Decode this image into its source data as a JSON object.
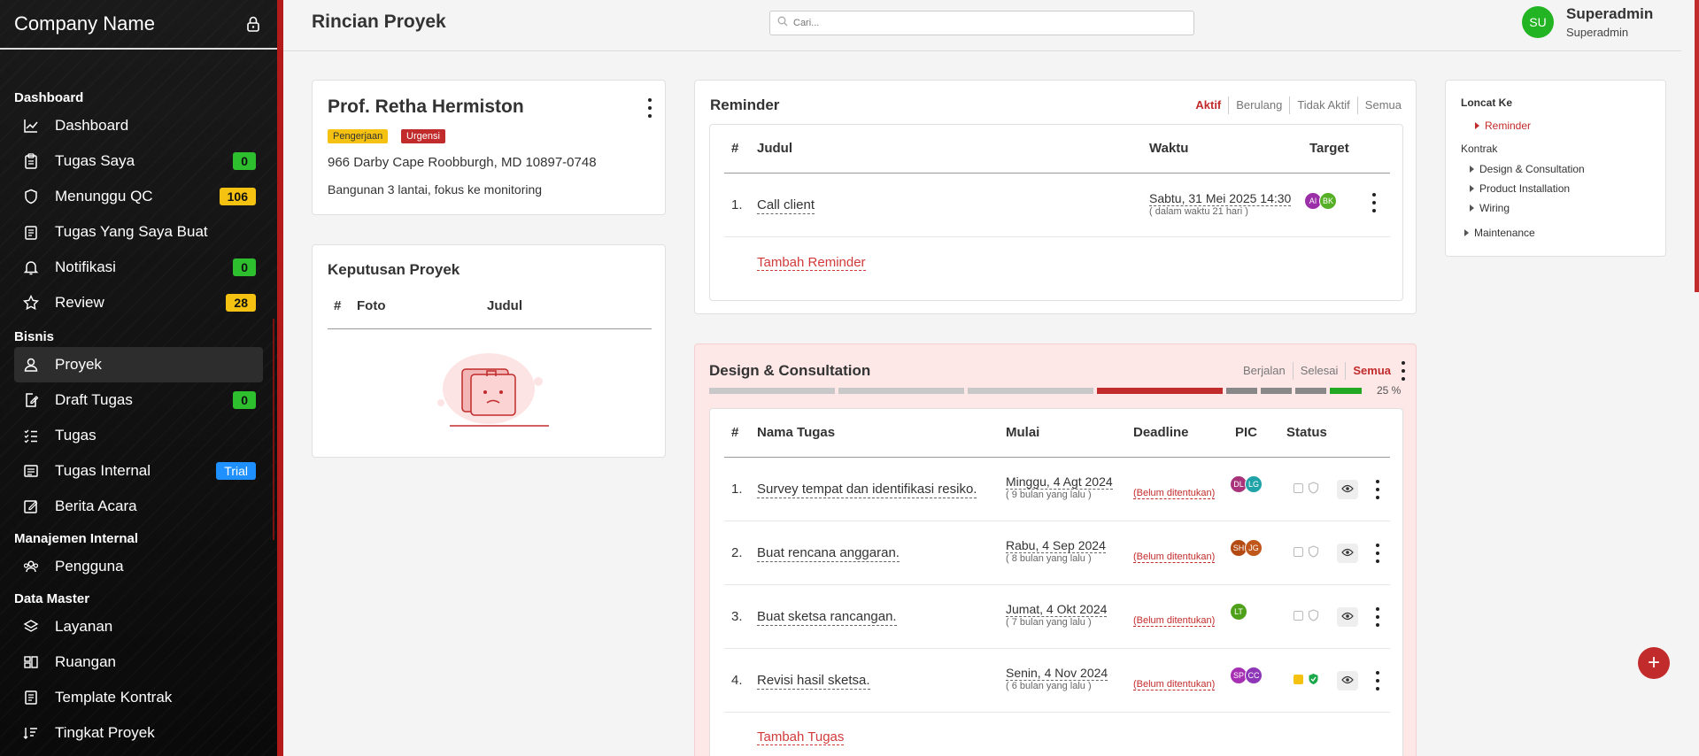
{
  "sidebar": {
    "brand": "Company Name",
    "sections": {
      "dashboard": "Dashboard",
      "bisnis": "Bisnis",
      "manajemen": "Manajemen Internal",
      "datamaster": "Data Master"
    },
    "items": {
      "dashboard": "Dashboard",
      "tugas_saya": "Tugas Saya",
      "menunggu_qc": "Menunggu QC",
      "tugas_dibuat": "Tugas Yang Saya Buat",
      "notifikasi": "Notifikasi",
      "review": "Review",
      "proyek": "Proyek",
      "draft_tugas": "Draft Tugas",
      "tugas": "Tugas",
      "tugas_internal": "Tugas Internal",
      "berita_acara": "Berita Acara",
      "pengguna": "Pengguna",
      "layanan": "Layanan",
      "ruangan": "Ruangan",
      "template_kontrak": "Template Kontrak",
      "tingkat_proyek": "Tingkat Proyek"
    },
    "badges": {
      "tugas_saya": "0",
      "menunggu_qc": "106",
      "notifikasi": "0",
      "review": "28",
      "draft_tugas": "0",
      "tugas_internal": "Trial"
    }
  },
  "header": {
    "title": "Rincian Proyek",
    "search_placeholder": "Cari...",
    "user_initials": "SU",
    "user_name": "Superadmin",
    "user_role": "Superadmin"
  },
  "client": {
    "name": "Prof. Retha Hermiston",
    "tag1": "Pengerjaan",
    "tag2": "Urgensi",
    "address": "966 Darby Cape Roobburgh, MD 10897-0748",
    "description": "Bangunan 3 lantai, fokus ke monitoring"
  },
  "keputusan": {
    "title": "Keputusan Proyek",
    "col_no": "#",
    "col_foto": "Foto",
    "col_judul": "Judul"
  },
  "reminder": {
    "title": "Reminder",
    "tabs": [
      "Aktif",
      "Berulang",
      "Tidak Aktif",
      "Semua"
    ],
    "col_no": "#",
    "col_judul": "Judul",
    "col_waktu": "Waktu",
    "col_target": "Target",
    "row": {
      "no": "1.",
      "judul": "Call client",
      "waktu": "Sabtu, 31 Mei 2025 14:30",
      "waktu_sub": "( dalam waktu 21 hari )",
      "targets": [
        "AI",
        "BK"
      ]
    },
    "add_label": "Tambah Reminder"
  },
  "design": {
    "title": "Design & Consultation",
    "tabs": [
      "Berjalan",
      "Selesai",
      "Semua"
    ],
    "progress": "25 %",
    "progress_segments": [
      "#c8c8c8",
      "#c8c8c8",
      "#c8c8c8",
      "#c22b2b",
      "#888888",
      "#888888",
      "#888888",
      "#22a822"
    ],
    "cols": {
      "no": "#",
      "nama": "Nama Tugas",
      "mulai": "Mulai",
      "deadline": "Deadline",
      "pic": "PIC",
      "status": "Status"
    },
    "rows": [
      {
        "no": "1.",
        "nama": "Survey tempat dan identifikasi resiko.",
        "mulai": "Minggu, 4 Agt 2024",
        "mulai_sub": "( 9 bulan yang lalu )",
        "deadline": "(Belum ditentukan)",
        "pic": [
          "DL",
          "LG"
        ],
        "done": false
      },
      {
        "no": "2.",
        "nama": "Buat rencana anggaran.",
        "mulai": "Rabu, 4 Sep 2024",
        "mulai_sub": "( 8 bulan yang lalu )",
        "deadline": "(Belum ditentukan)",
        "pic": [
          "SH",
          "JG"
        ],
        "done": false
      },
      {
        "no": "3.",
        "nama": "Buat sketsa rancangan.",
        "mulai": "Jumat, 4 Okt 2024",
        "mulai_sub": "( 7 bulan yang lalu )",
        "deadline": "(Belum ditentukan)",
        "pic": [
          "LT"
        ],
        "done": false
      },
      {
        "no": "4.",
        "nama": "Revisi hasil sketsa.",
        "mulai": "Senin, 4 Nov 2024",
        "mulai_sub": "( 6 bulan yang lalu )",
        "deadline": "(Belum ditentukan)",
        "pic": [
          "SP",
          "CC"
        ],
        "done": true
      }
    ],
    "add_label": "Tambah Tugas"
  },
  "jump": {
    "title": "Loncat Ke",
    "items": [
      "Reminder",
      "Kontrak",
      "Design & Consultation",
      "Product Installation",
      "Wiring",
      "Maintenance"
    ]
  },
  "fab": "+"
}
